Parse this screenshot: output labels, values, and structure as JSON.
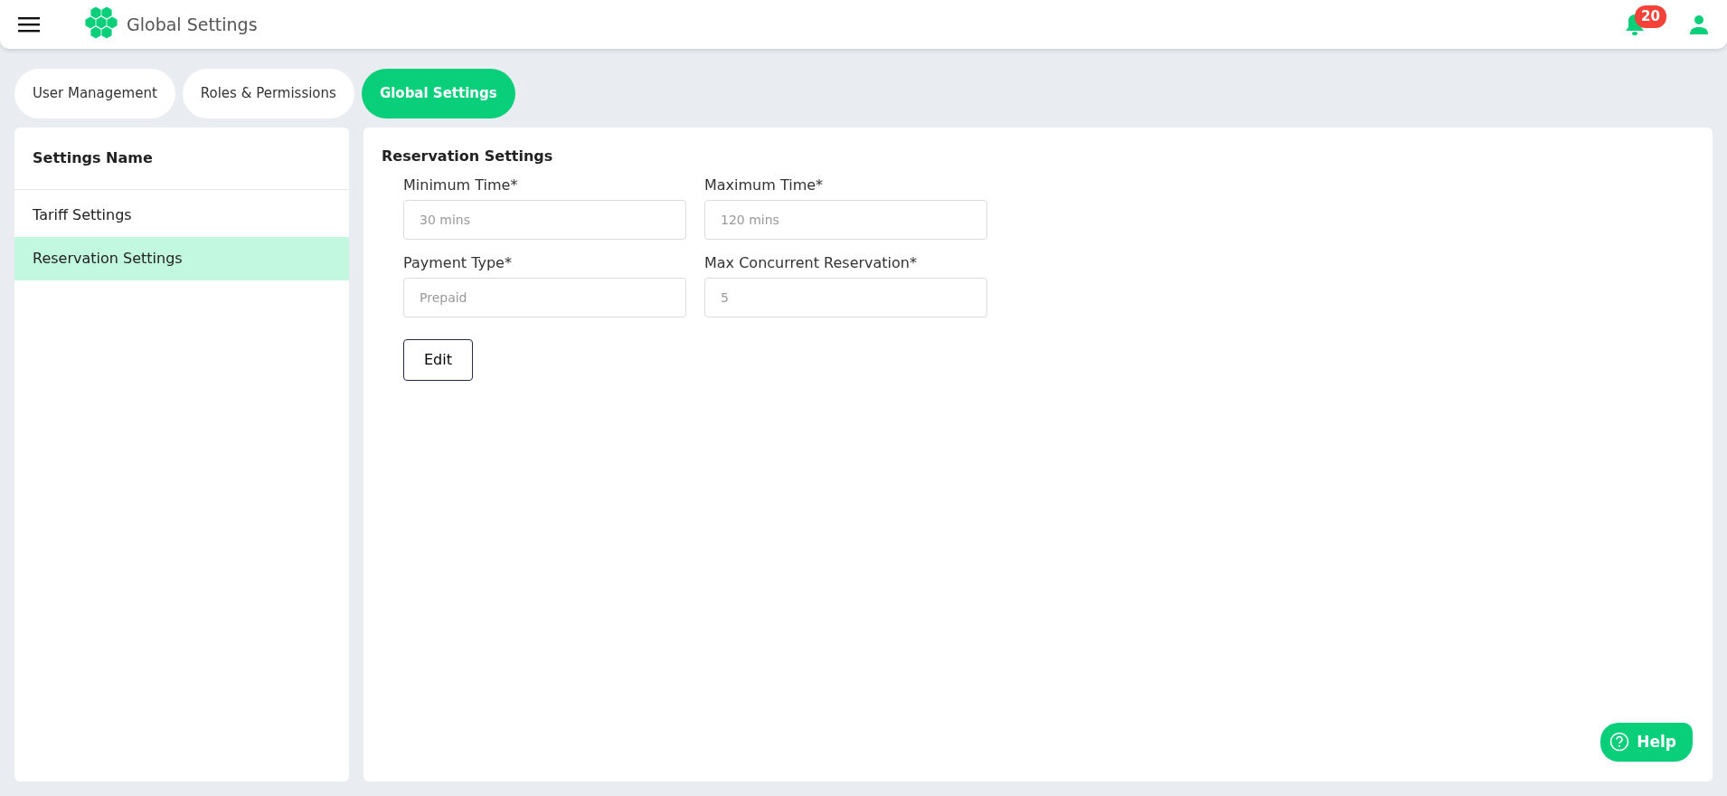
{
  "header": {
    "title": "Global Settings",
    "notification_count": "20"
  },
  "tabs": [
    {
      "label": "User Management",
      "selected": false
    },
    {
      "label": "Roles & Permissions",
      "selected": false
    },
    {
      "label": "Global Settings",
      "selected": true
    }
  ],
  "sidebar": {
    "heading": "Settings Name",
    "items": [
      {
        "label": "Tariff Settings",
        "selected": false
      },
      {
        "label": "Reservation Settings",
        "selected": true
      }
    ]
  },
  "form": {
    "title": "Reservation Settings",
    "fields": [
      {
        "label": "Minimum Time*",
        "placeholder": "30 mins"
      },
      {
        "label": "Maximum Time*",
        "placeholder": "120 mins"
      },
      {
        "label": "Payment Type*",
        "placeholder": "Prepaid"
      },
      {
        "label": "Max Concurrent Reservation*",
        "placeholder": "5"
      }
    ],
    "button": "Edit"
  },
  "help_button": "Help"
}
